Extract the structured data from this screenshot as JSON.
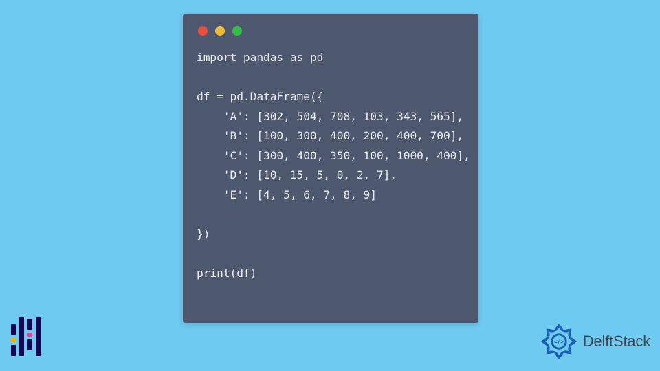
{
  "code": {
    "lines": [
      "import pandas as pd",
      "",
      "df = pd.DataFrame({",
      "    'A': [302, 504, 708, 103, 343, 565],",
      "    'B': [100, 300, 400, 200, 400, 700],",
      "    'C': [300, 400, 350, 100, 1000, 400],",
      "    'D': [10, 15, 5, 0, 2, 7],",
      "    'E': [4, 5, 6, 7, 8, 9]",
      "",
      "})",
      "",
      "print(df)"
    ]
  },
  "brand": {
    "name": "DelftStack"
  },
  "traffic_lights": {
    "red": "close",
    "yellow": "minimize",
    "green": "zoom"
  }
}
